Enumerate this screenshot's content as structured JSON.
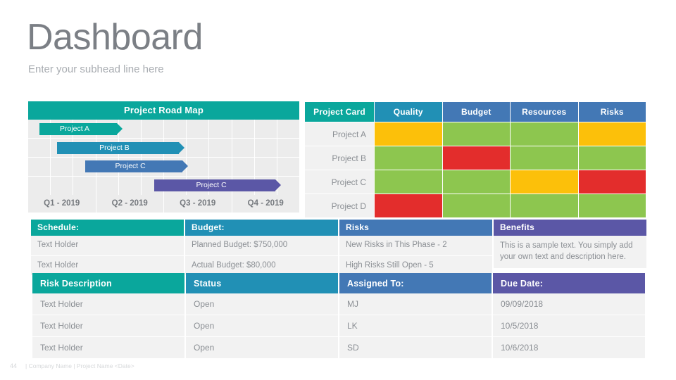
{
  "header": {
    "title": "Dashboard",
    "subtitle": "Enter your subhead line here"
  },
  "gantt": {
    "title": "Project Road Map",
    "columns": 12,
    "rows": 4,
    "bars": [
      {
        "label": "Project A",
        "color": "#0aa79c",
        "left_pct": 4.2,
        "width_pct": 28.5,
        "row": 0
      },
      {
        "label": "Project B",
        "color": "#2190b5",
        "left_pct": 10.6,
        "width_pct": 45.0,
        "row": 1
      },
      {
        "label": "Project C",
        "color": "#4378b5",
        "left_pct": 21.0,
        "width_pct": 36.0,
        "row": 2
      },
      {
        "label": "Project C",
        "color": "#5b57a6",
        "left_pct": 46.6,
        "width_pct": 44.5,
        "row": 3
      }
    ],
    "axis": [
      "Q1 - 2019",
      "Q2 - 2019",
      "Q3 - 2019",
      "Q4 - 2019"
    ]
  },
  "project_card": {
    "headers": [
      {
        "label": "Project Card",
        "color": "#0aa79c"
      },
      {
        "label": "Quality",
        "color": "#2190b5"
      },
      {
        "label": "Budget",
        "color": "#4378b5"
      },
      {
        "label": "Resources",
        "color": "#4378b5"
      },
      {
        "label": "Risks",
        "color": "#4378b5"
      }
    ],
    "rows": [
      {
        "label": "Project A",
        "statuses": [
          "#fcc00a",
          "#8dc64f",
          "#8dc64f",
          "#fcc00a"
        ]
      },
      {
        "label": "Project B",
        "statuses": [
          "#8dc64f",
          "#e32d2c",
          "#8dc64f",
          "#8dc64f"
        ]
      },
      {
        "label": "Project C",
        "statuses": [
          "#8dc64f",
          "#8dc64f",
          "#fcc00a",
          "#e32d2c"
        ]
      },
      {
        "label": "Project D",
        "statuses": [
          "#e32d2c",
          "#8dc64f",
          "#8dc64f",
          "#8dc64f"
        ]
      }
    ]
  },
  "info_strip": {
    "schedule": {
      "header": "Schedule:",
      "color": "#0aa79c",
      "rows": [
        "Text Holder",
        "Text Holder"
      ]
    },
    "budget": {
      "header": "Budget:",
      "color": "#2190b5",
      "rows": [
        "Planned Budget: $750,000",
        "Actual Budget: $80,000"
      ]
    },
    "risks": {
      "header": "Risks",
      "color": "#4378b5",
      "rows": [
        "New Risks in This Phase - 2",
        "High Risks Still Open - 5"
      ]
    },
    "benefits": {
      "header": "Benefits",
      "color": "#5b57a6",
      "body": "This is a sample text. You simply add your own text and description here."
    }
  },
  "risk_table": {
    "headers": [
      {
        "label": "Risk Description",
        "color": "#0aa79c"
      },
      {
        "label": "Status",
        "color": "#2190b5"
      },
      {
        "label": "Assigned To:",
        "color": "#4378b5"
      },
      {
        "label": "Due Date:",
        "color": "#5b57a6"
      }
    ],
    "rows": [
      [
        "Text Holder",
        "Open",
        "MJ",
        "09/09/2018"
      ],
      [
        "Text Holder",
        "Open",
        "LK",
        "10/5/2018"
      ],
      [
        "Text Holder",
        "Open",
        "SD",
        "10/6/2018"
      ]
    ]
  },
  "footer": {
    "page_number": "44",
    "text": "| Company Name | Project Name <Date>"
  }
}
